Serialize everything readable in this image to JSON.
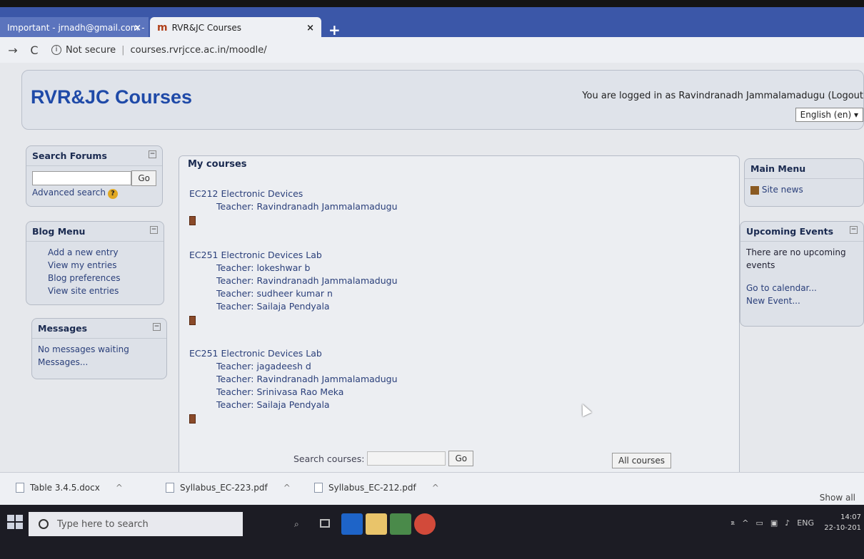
{
  "browser": {
    "tabs": [
      {
        "label": "Important - jrnadh@gmail.com -"
      },
      {
        "label": "RVR&JC Courses",
        "favicon": "m"
      }
    ],
    "close_glyph": "×",
    "new_tab_glyph": "+",
    "nav": {
      "back": "→",
      "reload": "C"
    },
    "address": {
      "security": "Not secure",
      "url": "courses.rvrjcce.ac.in/moodle/"
    }
  },
  "header": {
    "site_title": "RVR&JC Courses",
    "login_text": "You are logged in as Ravindranadh Jammalamadugu (Logout",
    "language": "English (en) ▾"
  },
  "search_forums": {
    "title": "Search Forums",
    "go": "Go",
    "advanced": "Advanced search"
  },
  "blog_menu": {
    "title": "Blog Menu",
    "items": [
      "Add a new entry",
      "View my entries",
      "Blog preferences",
      "View site entries"
    ]
  },
  "messages": {
    "title": "Messages",
    "status": "No messages waiting",
    "link": "Messages..."
  },
  "my_courses": {
    "title": "My courses",
    "courses": [
      {
        "name": "EC212 Electronic Devices",
        "teachers": [
          "Teacher: Ravindranadh Jammalamadugu"
        ]
      },
      {
        "name": "EC251 Electronic Devices Lab",
        "teachers": [
          "Teacher: lokeshwar b",
          "Teacher: Ravindranadh Jammalamadugu",
          "Teacher: sudheer kumar n",
          "Teacher: Sailaja Pendyala"
        ]
      },
      {
        "name": "EC251 Electronic Devices Lab",
        "teachers": [
          "Teacher: jagadeesh d",
          "Teacher: Ravindranadh Jammalamadugu",
          "Teacher: Srinivasa Rao Meka",
          "Teacher: Sailaja Pendyala"
        ]
      }
    ],
    "search_label": "Search courses:",
    "search_go": "Go",
    "all_courses": "All courses"
  },
  "main_menu": {
    "title": "Main Menu",
    "site_news": "Site news"
  },
  "upcoming_events": {
    "title": "Upcoming Events",
    "status": "There are no upcoming events",
    "calendar": "Go to calendar...",
    "new_event": "New Event..."
  },
  "downloads": {
    "files": [
      "Table 3.4.5.docx",
      "Syllabus_EC-223.pdf",
      "Syllabus_EC-212.pdf"
    ],
    "show_all": "Show all"
  },
  "taskbar": {
    "search_placeholder": "Type here to search",
    "tray": {
      "language": "ENG"
    },
    "clock": {
      "time": "14:07",
      "date": "22-10-201"
    }
  },
  "colors": {
    "brand": "#1f4aa8",
    "tab_bar": "#3b57a8",
    "link": "#2a3f7a"
  }
}
